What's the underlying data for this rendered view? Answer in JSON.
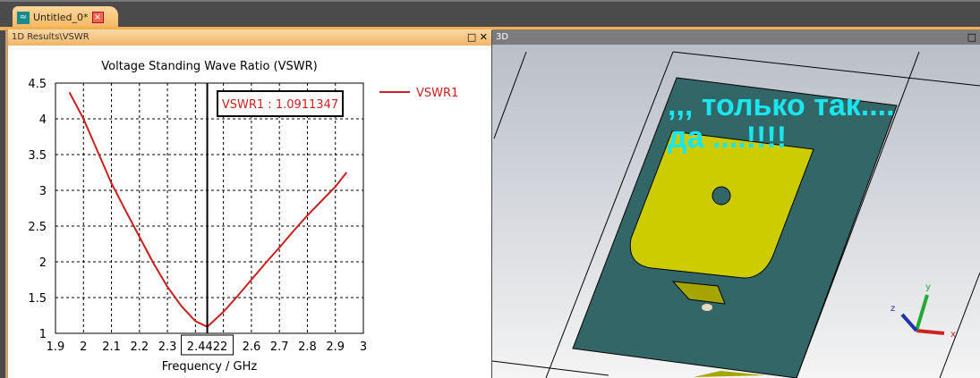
{
  "tab": {
    "title": "Untitled_0*",
    "icon": "wave-icon",
    "close_icon": "close-icon"
  },
  "left_panel": {
    "title": "1D Results\\VSWR",
    "maximize": "□",
    "close": "✕"
  },
  "right_panel": {
    "title": "3D",
    "maximize": "□",
    "overlay_line1": ",,, только так....",
    "overlay_line2": "да ....!!!!",
    "axes": {
      "x": "x",
      "y": "y",
      "z": "z"
    }
  },
  "chart_data": {
    "type": "line",
    "title": "Voltage Standing Wave Ratio (VSWR)",
    "xlabel": "Frequency / GHz",
    "ylabel": "",
    "xlim": [
      1.9,
      3
    ],
    "ylim": [
      1,
      4.5
    ],
    "xticks": [
      "1.9",
      "2",
      "2.1",
      "2.2",
      "2.3",
      "2.4",
      "2.5",
      "2.6",
      "2.7",
      "2.8",
      "2.9",
      "3"
    ],
    "yticks": [
      "1",
      "1.5",
      "2",
      "2.5",
      "3",
      "3.5",
      "4",
      "4.5"
    ],
    "grid": true,
    "legend": "right",
    "series": [
      {
        "name": "VSWR1",
        "color": "#cc1e1e",
        "x": [
          1.95,
          2.0,
          2.05,
          2.1,
          2.15,
          2.2,
          2.25,
          2.3,
          2.35,
          2.4,
          2.4422,
          2.5,
          2.55,
          2.6,
          2.65,
          2.7,
          2.75,
          2.8,
          2.85,
          2.9,
          2.94
        ],
        "y": [
          4.37,
          4.0,
          3.55,
          3.1,
          2.72,
          2.35,
          1.98,
          1.65,
          1.38,
          1.17,
          1.0911347,
          1.3,
          1.52,
          1.75,
          1.98,
          2.2,
          2.43,
          2.65,
          2.85,
          3.05,
          3.25
        ]
      }
    ],
    "marker": {
      "x": 2.4422,
      "x_label": "2.4422",
      "label": "VSWR1 : 1.0911347"
    }
  }
}
